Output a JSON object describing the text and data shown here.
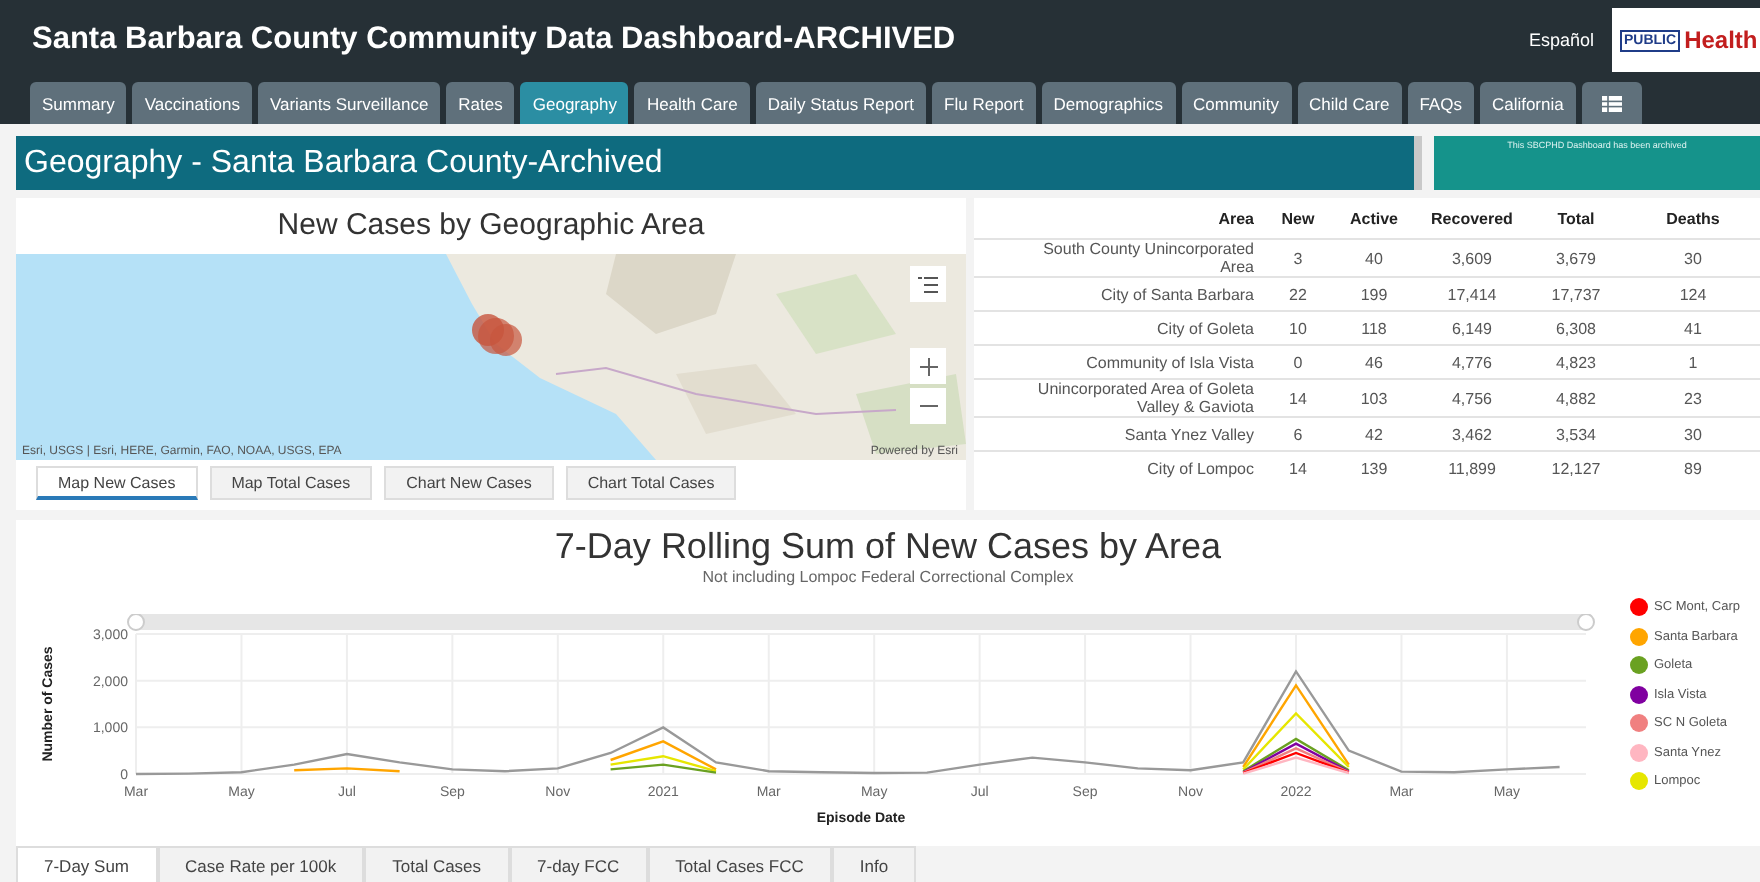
{
  "header": {
    "title": "Santa Barbara County Community Data Dashboard-ARCHIVED",
    "language_link": "Español",
    "logo": {
      "line1": "PUBLIC",
      "line2": "Health"
    }
  },
  "nav_tabs": [
    {
      "kind": "text",
      "label": "Summary",
      "selected": false
    },
    {
      "kind": "text",
      "label": "Vaccinations",
      "selected": false
    },
    {
      "kind": "text",
      "label": "Variants Surveillance",
      "selected": false
    },
    {
      "kind": "text",
      "label": "Rates",
      "selected": false
    },
    {
      "kind": "text",
      "label": "Geography",
      "selected": true
    },
    {
      "kind": "text",
      "label": "Health Care",
      "selected": false
    },
    {
      "kind": "text",
      "label": "Daily Status Report",
      "selected": false
    },
    {
      "kind": "text",
      "label": "Flu Report",
      "selected": false
    },
    {
      "kind": "text",
      "label": "Demographics",
      "selected": false
    },
    {
      "kind": "text",
      "label": "Community",
      "selected": false
    },
    {
      "kind": "text",
      "label": "Child Care",
      "selected": false
    },
    {
      "kind": "text",
      "label": "FAQs",
      "selected": false
    },
    {
      "kind": "text",
      "label": "California",
      "selected": false
    },
    {
      "kind": "icon",
      "selected": false
    }
  ],
  "page_title": "Geography - Santa Barbara County-Archived",
  "archive_notice": "This SBCPHD Dashboard has been archived",
  "map_panel": {
    "title": "New Cases by Geographic Area",
    "attribution": "Esri, USGS | Esri, HERE, Garmin, FAO, NOAA, USGS, EPA",
    "powered_by": "Powered by Esri",
    "tabs": [
      {
        "label": "Map New Cases",
        "selected": true
      },
      {
        "label": "Map Total Cases",
        "selected": false
      },
      {
        "label": "Chart New Cases",
        "selected": false
      },
      {
        "label": "Chart Total Cases",
        "selected": false
      }
    ]
  },
  "table": {
    "columns": [
      "Area",
      "New",
      "Active",
      "Recovered",
      "Total",
      "Deaths"
    ],
    "rows": [
      [
        "South County Unincorporated Area",
        "3",
        "40",
        "3,609",
        "3,679",
        "30"
      ],
      [
        "City of Santa Barbara",
        "22",
        "199",
        "17,414",
        "17,737",
        "124"
      ],
      [
        "City of Goleta",
        "10",
        "118",
        "6,149",
        "6,308",
        "41"
      ],
      [
        "Community of Isla Vista",
        "0",
        "46",
        "4,776",
        "4,823",
        "1"
      ],
      [
        "Unincorporated Area of Goleta Valley & Gaviota",
        "14",
        "103",
        "4,756",
        "4,882",
        "23"
      ],
      [
        "Santa Ynez Valley",
        "6",
        "42",
        "3,462",
        "3,534",
        "30"
      ],
      [
        "City of Lompoc",
        "14",
        "139",
        "11,899",
        "12,127",
        "89"
      ]
    ]
  },
  "chart_panel": {
    "title": "7-Day Rolling Sum of New Cases by Area",
    "subtitle": "Not including Lompoc Federal Correctional Complex",
    "chart_data": {
      "type": "line",
      "grid": true,
      "xlabel": "Episode Date",
      "ylabel": "Number of Cases",
      "categories": [
        "Mar",
        null,
        "May",
        null,
        "Jul",
        null,
        "Sep",
        null,
        "Nov",
        null,
        "2021",
        null,
        "Mar",
        null,
        "May",
        null,
        "Jul",
        null,
        "Sep",
        null,
        "Nov",
        null,
        "2022",
        null,
        "Mar",
        null,
        "May",
        null
      ],
      "ylim": [
        0,
        3000
      ],
      "yticks": [
        {
          "value": 0,
          "label": "0"
        },
        {
          "value": 1000,
          "label": "1,000"
        },
        {
          "value": 2000,
          "label": "2,000"
        },
        {
          "value": 3000,
          "label": "3,000"
        }
      ],
      "series": [
        {
          "color": "#999999",
          "values": [
            0,
            10,
            40,
            200,
            430,
            250,
            100,
            60,
            120,
            450,
            1000,
            250,
            60,
            40,
            20,
            30,
            200,
            350,
            250,
            120,
            80,
            250,
            2200,
            500,
            50,
            40,
            100,
            150
          ]
        },
        {
          "name": "SC Mont, Carp",
          "color": "#ff0000",
          "values": [
            null,
            null,
            null,
            null,
            null,
            null,
            null,
            null,
            null,
            null,
            null,
            null,
            null,
            null,
            null,
            null,
            null,
            null,
            null,
            null,
            null,
            20,
            450,
            30,
            null,
            null,
            null,
            null
          ]
        },
        {
          "name": "Santa Barbara",
          "color": "#ffa500",
          "values": [
            null,
            null,
            null,
            80,
            120,
            60,
            null,
            null,
            null,
            300,
            700,
            100,
            null,
            null,
            null,
            null,
            null,
            null,
            null,
            null,
            null,
            150,
            1900,
            200,
            null,
            null,
            null,
            null
          ]
        },
        {
          "name": "Goleta",
          "color": "#6aa121",
          "values": [
            null,
            null,
            null,
            null,
            null,
            null,
            null,
            null,
            null,
            100,
            200,
            30,
            null,
            null,
            null,
            null,
            null,
            null,
            null,
            null,
            null,
            60,
            750,
            80,
            null,
            null,
            null,
            null
          ]
        },
        {
          "name": "Isla Vista",
          "color": "#8000a0",
          "values": [
            null,
            null,
            null,
            null,
            null,
            null,
            null,
            null,
            null,
            null,
            null,
            null,
            null,
            null,
            null,
            null,
            null,
            null,
            null,
            null,
            null,
            40,
            650,
            50,
            null,
            null,
            null,
            null
          ]
        },
        {
          "name": "SC N Goleta",
          "color": "#f08080",
          "values": [
            null,
            null,
            null,
            null,
            null,
            null,
            null,
            null,
            null,
            null,
            null,
            null,
            null,
            null,
            null,
            null,
            null,
            null,
            null,
            null,
            null,
            30,
            550,
            40,
            null,
            null,
            null,
            null
          ]
        },
        {
          "name": "Santa Ynez",
          "color": "#ffb6c1",
          "values": [
            null,
            null,
            null,
            null,
            null,
            null,
            null,
            null,
            null,
            null,
            null,
            null,
            null,
            null,
            null,
            null,
            null,
            null,
            null,
            null,
            null,
            10,
            350,
            20,
            null,
            null,
            null,
            null
          ]
        },
        {
          "name": "Lompoc",
          "color": "#e6e600",
          "values": [
            null,
            null,
            null,
            null,
            null,
            null,
            null,
            null,
            null,
            200,
            380,
            60,
            null,
            null,
            null,
            null,
            null,
            null,
            null,
            null,
            null,
            100,
            1300,
            150,
            null,
            null,
            null,
            null
          ]
        }
      ]
    },
    "tabs": [
      {
        "label": "7-Day Sum",
        "selected": true
      },
      {
        "label": "Case Rate per 100k",
        "selected": false
      },
      {
        "label": "Total Cases",
        "selected": false
      },
      {
        "label": "7-day FCC",
        "selected": false
      },
      {
        "label": "Total Cases FCC",
        "selected": false
      },
      {
        "label": "Info",
        "selected": false
      }
    ]
  }
}
